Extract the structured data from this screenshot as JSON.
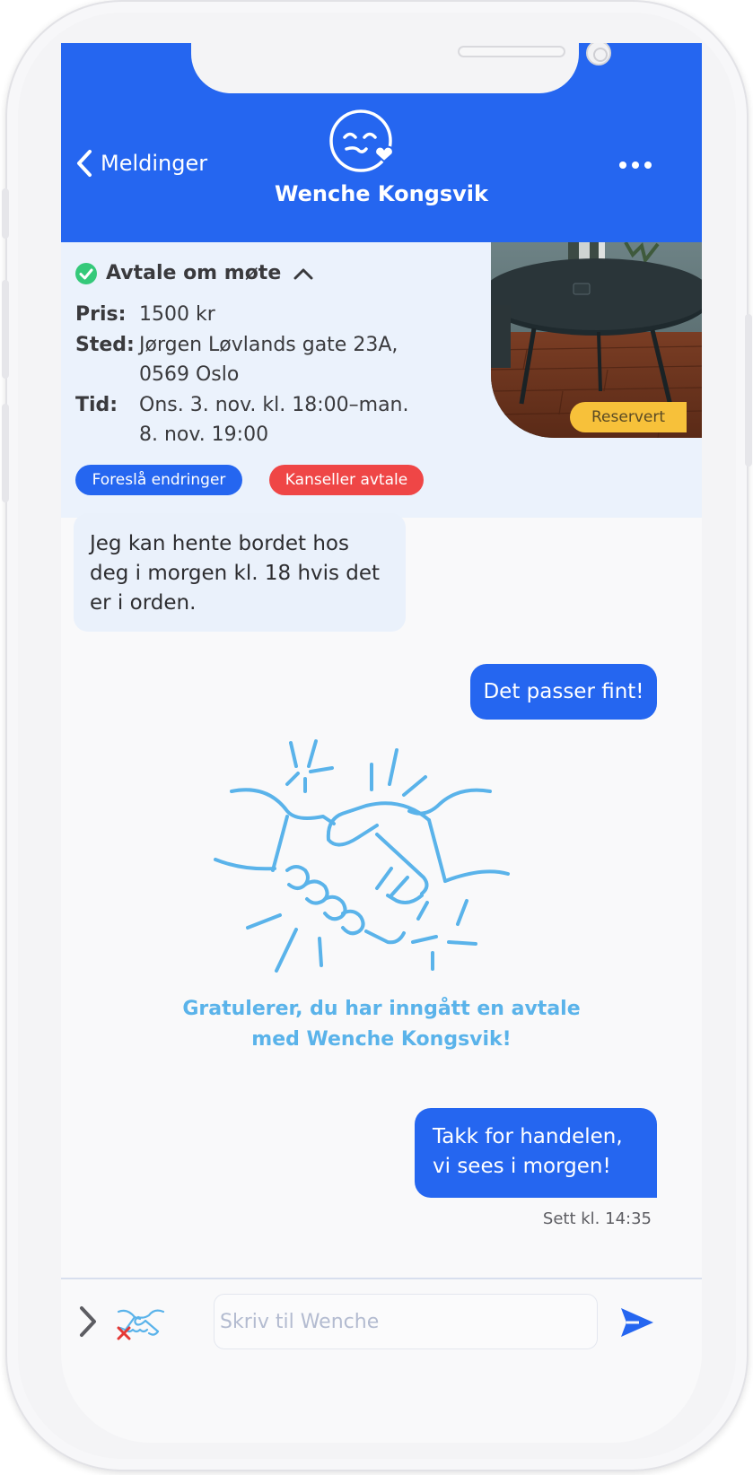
{
  "header": {
    "back_label": "Meldinger",
    "contact_name": "Wenche Kongsvik",
    "accent_color": "#2566f0"
  },
  "deal": {
    "title": "Avtale om møte",
    "price_label": "Pris:",
    "price_value": "1500 kr",
    "place_label": "Sted:",
    "place_line1": "Jørgen Løvlands gate 23A,",
    "place_line2": "0569 Oslo",
    "time_label": "Tid:",
    "time_line1": "Ons. 3. nov. kl. 18:00–man.",
    "time_line2": "8. nov. 19:00",
    "status_badge": "Reservert",
    "suggest_button": "Foreslå endringer",
    "cancel_button": "Kanseller avtale"
  },
  "messages": {
    "incoming_1": "Jeg kan hente bordet hos deg i morgen kl. 18 hvis det er i orden.",
    "outgoing_1": "Det passer fint!",
    "congrats_line1": "Gratulerer, du har inngått en avtale",
    "congrats_line2": "med Wenche Kongsvik!",
    "outgoing_2": "Takk for handelen, vi sees i morgen!",
    "seen_status": "Sett kl. 14:35"
  },
  "composer": {
    "placeholder": "Skriv til Wenche",
    "value": ""
  },
  "icons": {
    "back": "chevron-left-icon",
    "avatar": "smiley-heart-icon",
    "more": "more-dots-icon",
    "verified": "check-circle-icon",
    "collapse": "chevron-up-icon",
    "expand": "chevron-right-icon",
    "cancel_deal": "handshake-cancel-icon",
    "send": "send-icon"
  }
}
